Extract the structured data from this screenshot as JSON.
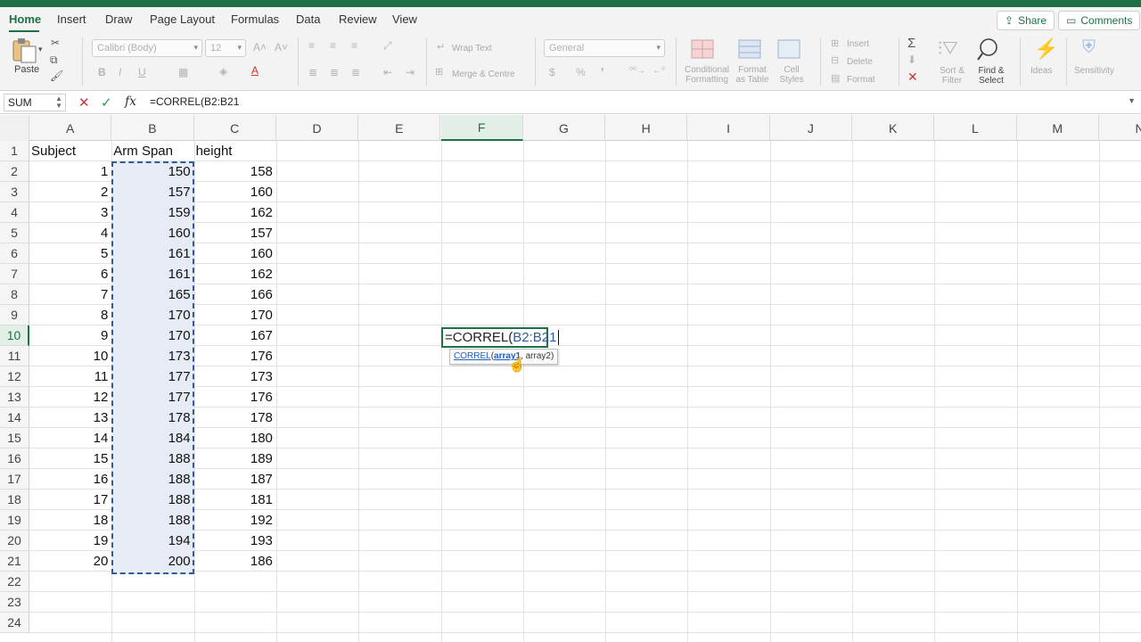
{
  "ribbon_tabs": [
    "Home",
    "Insert",
    "Draw",
    "Page Layout",
    "Formulas",
    "Data",
    "Review",
    "View"
  ],
  "share_label": "Share",
  "comments_label": "Comments",
  "ribbon": {
    "paste": "Paste",
    "font_name": "Calibri (Body)",
    "font_size": "12",
    "wrap_text": "Wrap Text",
    "merge_centre": "Merge & Centre",
    "number_format": "General",
    "conditional_formatting": [
      "Conditional",
      "Formatting"
    ],
    "format_as_table": [
      "Format",
      "as Table"
    ],
    "cell_styles": [
      "Cell",
      "Styles"
    ],
    "insert": "Insert",
    "delete": "Delete",
    "format": "Format",
    "sort_filter": [
      "Sort &",
      "Filter"
    ],
    "find_select": [
      "Find &",
      "Select"
    ],
    "ideas": "Ideas",
    "sensitivity": "Sensitivity"
  },
  "formula_bar": {
    "name_box": "SUM",
    "cancel_icon": "✕",
    "enter_icon": "✓",
    "fx": "fx",
    "content": "=CORREL(B2:B21"
  },
  "columns": [
    "A",
    "B",
    "C",
    "D",
    "E",
    "F",
    "G",
    "H",
    "I",
    "J",
    "K",
    "L",
    "M",
    "N"
  ],
  "active_column": "F",
  "active_row": 10,
  "rows": [
    1,
    2,
    3,
    4,
    5,
    6,
    7,
    8,
    9,
    10,
    11,
    12,
    13,
    14,
    15,
    16,
    17,
    18,
    19,
    20,
    21,
    22,
    23,
    24
  ],
  "headers": {
    "A": "Subject",
    "B": "Arm Span",
    "C": "height"
  },
  "data": [
    [
      1,
      150,
      158
    ],
    [
      2,
      157,
      160
    ],
    [
      3,
      159,
      162
    ],
    [
      4,
      160,
      157
    ],
    [
      5,
      161,
      160
    ],
    [
      6,
      161,
      162
    ],
    [
      7,
      165,
      166
    ],
    [
      8,
      170,
      170
    ],
    [
      9,
      170,
      167
    ],
    [
      10,
      173,
      176
    ],
    [
      11,
      177,
      173
    ],
    [
      12,
      177,
      176
    ],
    [
      13,
      178,
      178
    ],
    [
      14,
      184,
      180
    ],
    [
      15,
      188,
      189
    ],
    [
      16,
      188,
      187
    ],
    [
      17,
      188,
      181
    ],
    [
      18,
      188,
      192
    ],
    [
      19,
      194,
      193
    ],
    [
      20,
      200,
      186
    ]
  ],
  "edit_cell": {
    "prefix": "=CORREL(",
    "ref": "B2:B21"
  },
  "tooltip": {
    "fn": "CORREL",
    "open": "(",
    "arg1": "array1",
    "rest": ", array2)"
  },
  "colors": {
    "excel_green": "#1f7145",
    "selection_fill": "#e6ebf6",
    "selection_border": "#2f5c9a"
  }
}
